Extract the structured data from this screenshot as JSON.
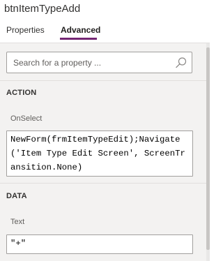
{
  "header": {
    "control_name": "btnItemTypeAdd",
    "tabs": [
      {
        "label": "Properties",
        "active": false
      },
      {
        "label": "Advanced",
        "active": true
      }
    ]
  },
  "search": {
    "placeholder": "Search for a property ..."
  },
  "sections": [
    {
      "title": "ACTION",
      "property": {
        "label": "OnSelect",
        "value": "NewForm(frmItemTypeEdit);Navigate('Item Type Edit Screen', ScreenTransition.None)"
      }
    },
    {
      "title": "DATA",
      "property": {
        "label": "Text",
        "value": "\"+\""
      }
    }
  ],
  "colors": {
    "accent": "#742774",
    "panel_bg": "#f3f2f1",
    "border": "#a19f9d"
  }
}
